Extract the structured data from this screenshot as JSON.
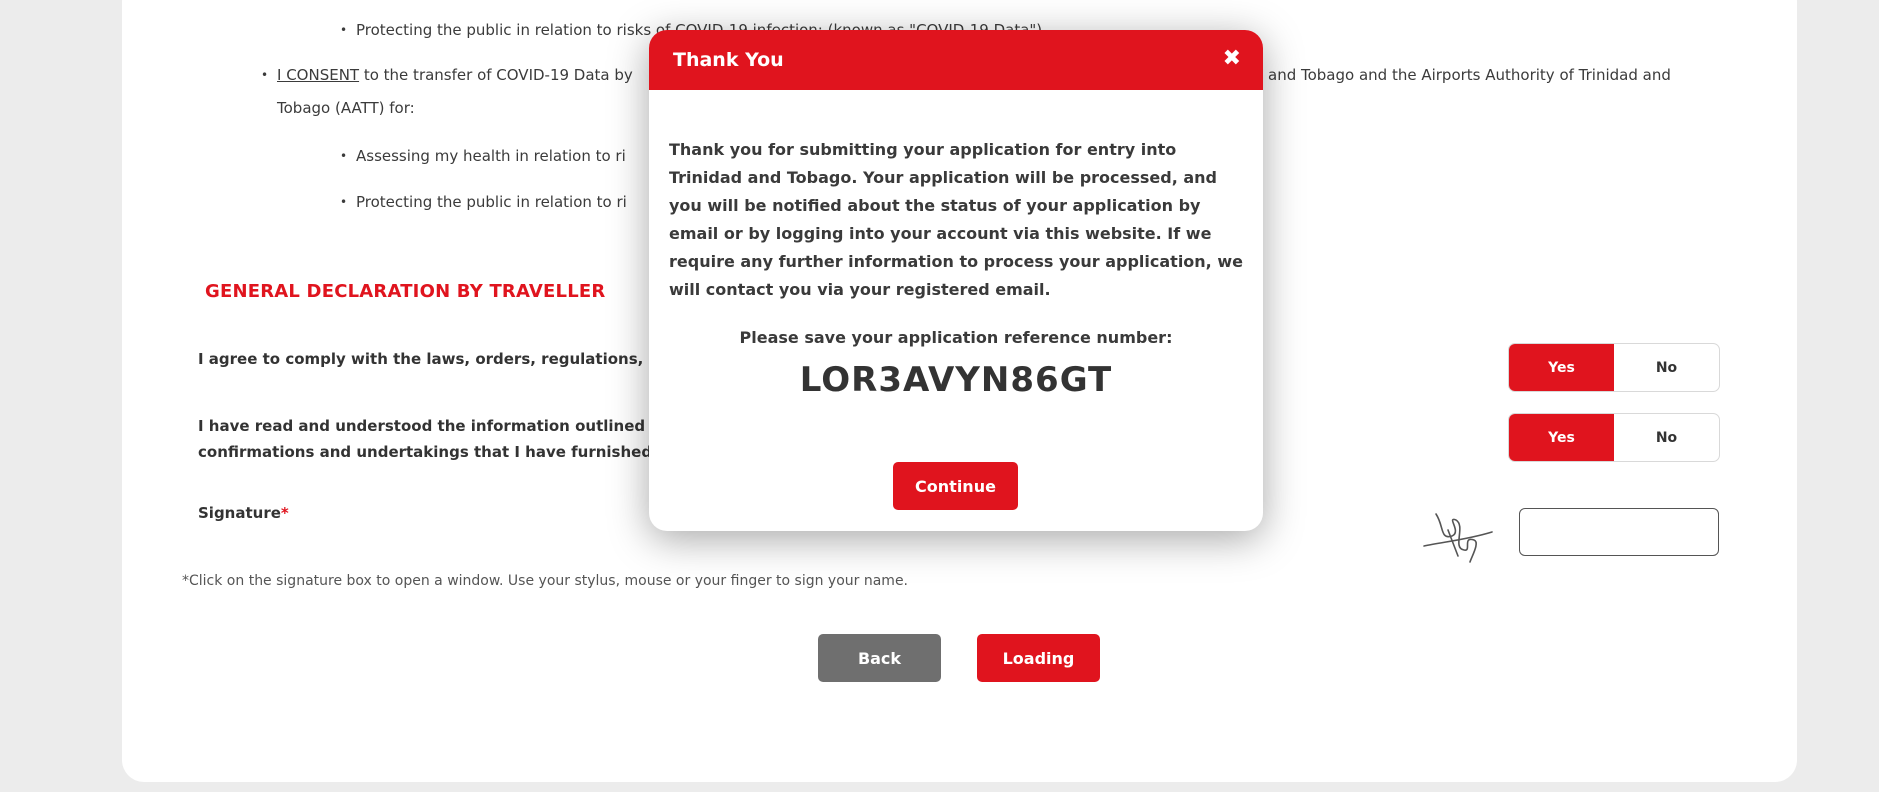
{
  "consent_section": {
    "bullet_top": "Protecting the public in relation to risks of COVID-19 infection; (known as \"COVID-19 Data\")",
    "consent_keyword": "I CONSENT",
    "consent_text_left": " to the transfer of COVID-19 Data by",
    "consent_text_right": "and Tobago and the Airports Authority of Trinidad and",
    "consent_text_line2": "Tobago (AATT) for:",
    "sub_bullet_1": "Assessing my health in relation to ri",
    "sub_bullet_2": "Protecting the public in relation to ri"
  },
  "declaration": {
    "title": "GENERAL DECLARATION BY TRAVELLER",
    "q1": "I agree to comply with the laws, orders, regulations, me",
    "q2_line1": "I have read and understood the information outlined in",
    "q2_line2": "confirmations and undertakings that I have furnished i",
    "yes_label": "Yes",
    "no_label": "No",
    "signature_label": "Signature",
    "required_mark": "*",
    "signature_note_mark": "*",
    "signature_note": "Click on the signature box to open a window. Use your stylus, mouse or your finger to sign your name."
  },
  "actions": {
    "back_label": "Back",
    "loading_label": "Loading"
  },
  "modal": {
    "title": "Thank You",
    "close_glyph": "✖",
    "message": "Thank you for submitting your application for entry into Trinidad and Tobago. Your application will be processed, and you will be notified about the status of your application by email or by logging into your account via this website. If we require any further information to process your application, we will contact you via your registered email.",
    "ref_label": "Please save your application reference number:",
    "ref_number": "LOR3AVYN86GT",
    "continue_label": "Continue"
  },
  "colors": {
    "accent": "#e0141e",
    "grey_button": "#6f6f6f",
    "page_bg": "#ececec"
  },
  "icons": [
    "signature-scribble-icon",
    "close-icon"
  ]
}
